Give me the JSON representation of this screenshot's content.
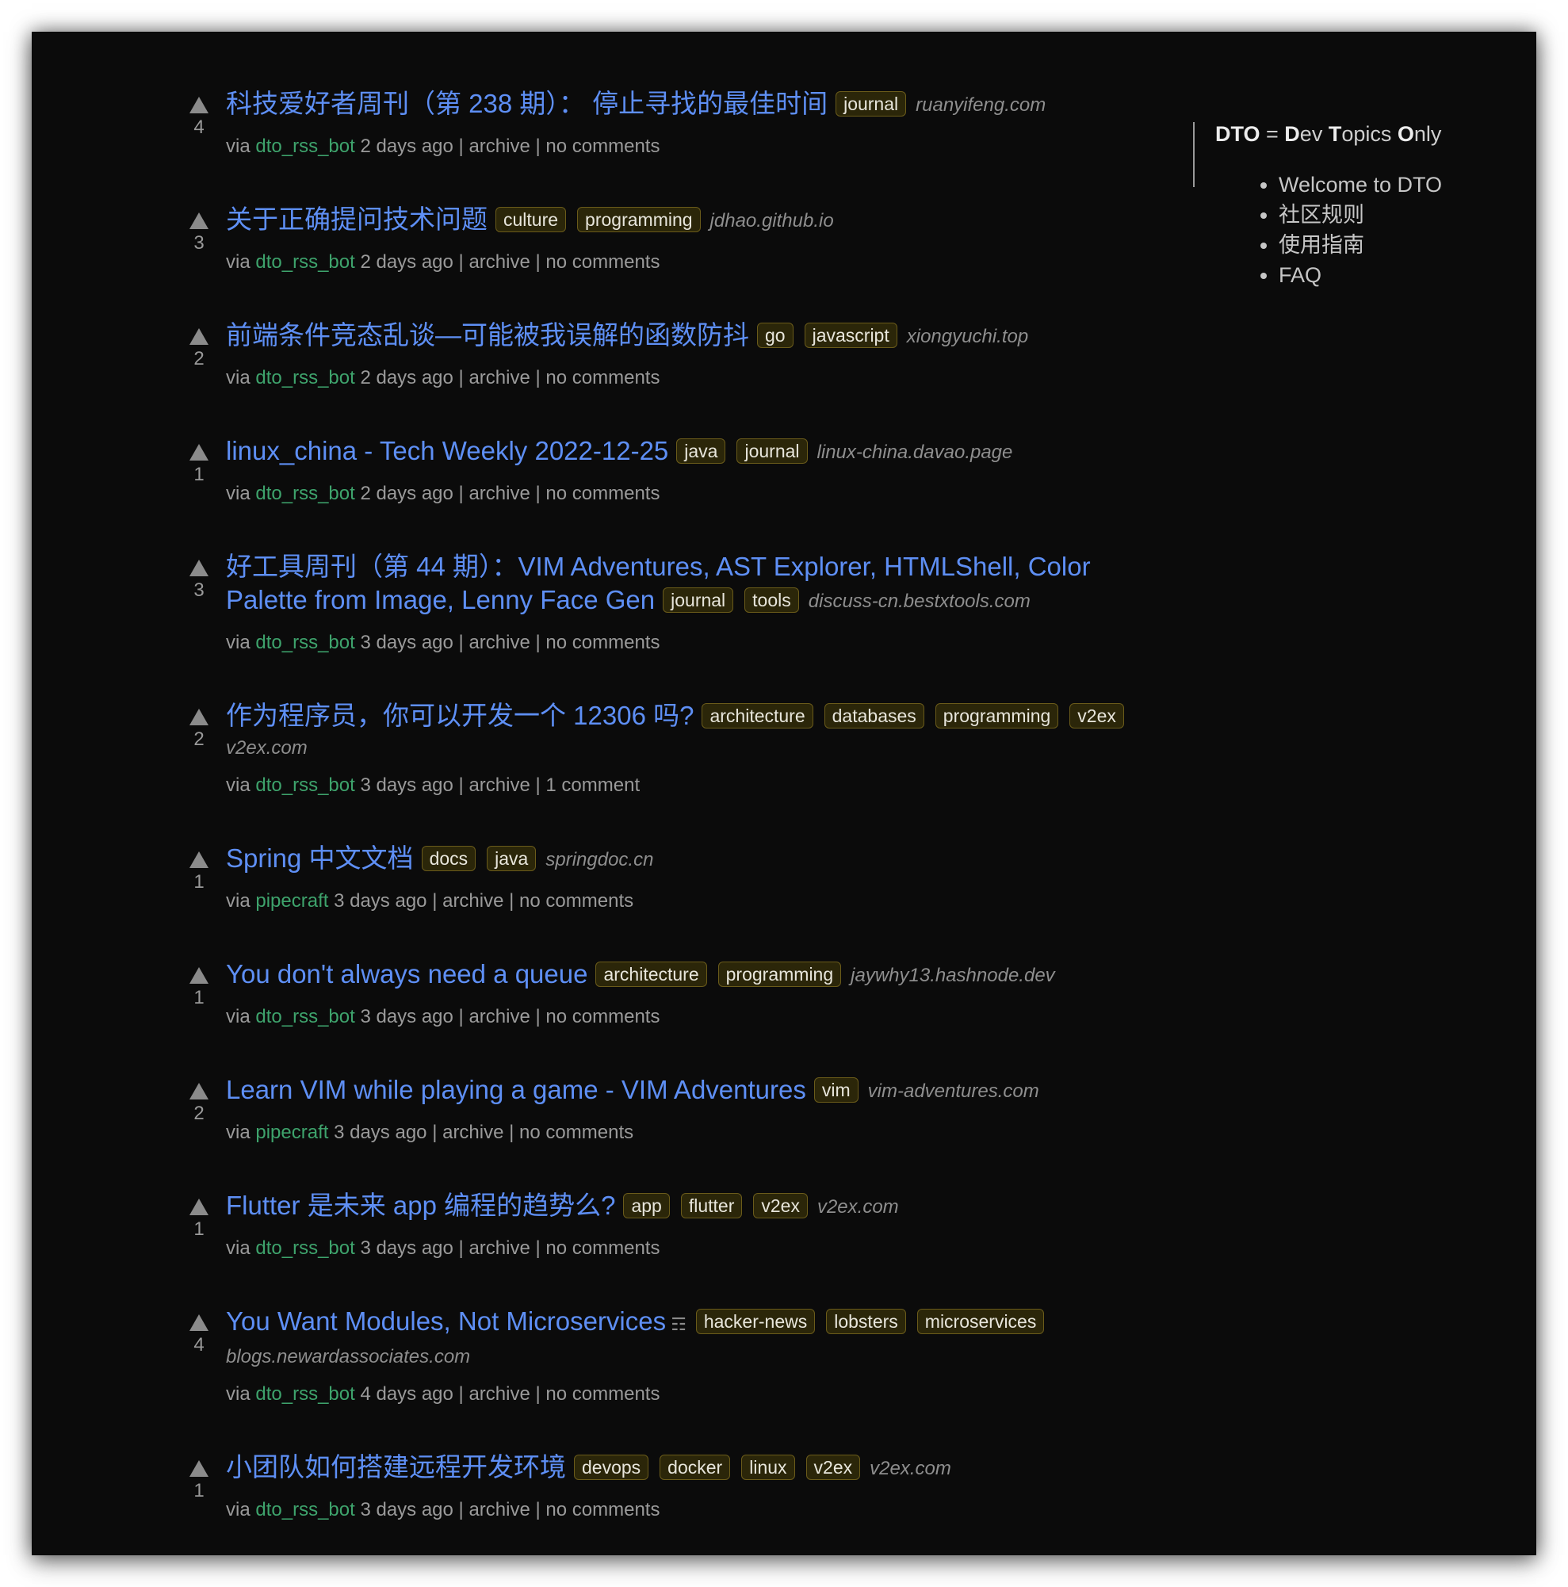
{
  "sidebar": {
    "heading_parts": [
      "DTO",
      " = ",
      "D",
      "ev ",
      "T",
      "opics ",
      "O",
      "nly"
    ],
    "links": [
      "Welcome to DTO",
      "社区规则",
      "使用指南",
      "FAQ"
    ]
  },
  "labels": {
    "via": "via",
    "archive": "archive",
    "separator": "|"
  },
  "colors": {
    "background": "#0b0b0b",
    "title_link": "#5e8ff5",
    "user_link": "#3ea36c",
    "tag_background": "#2b2609",
    "tag_border": "#6a5b1a",
    "muted_text": "#9a9a9a"
  },
  "stories": [
    {
      "score": "4",
      "title": "科技爱好者周刊（第 238 期）： 停止寻找的最佳时间",
      "tags": [
        "journal"
      ],
      "domain": "ruanyifeng.com",
      "user": "dto_rss_bot",
      "time": "2 days ago",
      "comments": "no comments"
    },
    {
      "score": "3",
      "title": "关于正确提问技术问题",
      "tags": [
        "culture",
        "programming"
      ],
      "domain": "jdhao.github.io",
      "user": "dto_rss_bot",
      "time": "2 days ago",
      "comments": "no comments"
    },
    {
      "score": "2",
      "title": "前端条件竞态乱谈—可能被我误解的函数防抖",
      "tags": [
        "go",
        "javascript"
      ],
      "domain": "xiongyuchi.top",
      "user": "dto_rss_bot",
      "time": "2 days ago",
      "comments": "no comments"
    },
    {
      "score": "1",
      "title": "linux_china - Tech Weekly 2022-12-25",
      "tags": [
        "java",
        "journal"
      ],
      "domain": "linux-china.davao.page",
      "user": "dto_rss_bot",
      "time": "2 days ago",
      "comments": "no comments"
    },
    {
      "score": "3",
      "title": "好工具周刊（第 44 期）：VIM Adventures, AST Explorer, HTMLShell, Color Palette from Image, Lenny Face Gen",
      "tags": [
        "journal",
        "tools"
      ],
      "domain": "discuss-cn.bestxtools.com",
      "user": "dto_rss_bot",
      "time": "3 days ago",
      "comments": "no comments"
    },
    {
      "score": "2",
      "title": "作为程序员，你可以开发一个 12306 吗?",
      "tags": [
        "architecture",
        "databases",
        "programming",
        "v2ex"
      ],
      "domain": "v2ex.com",
      "domain_block": true,
      "user": "dto_rss_bot",
      "time": "3 days ago",
      "comments": "1 comment"
    },
    {
      "score": "1",
      "title": "Spring 中文文档",
      "tags": [
        "docs",
        "java"
      ],
      "domain": "springdoc.cn",
      "user": "pipecraft",
      "time": "3 days ago",
      "comments": "no comments"
    },
    {
      "score": "1",
      "title": "You don't always need a queue",
      "tags": [
        "architecture",
        "programming"
      ],
      "domain": "jaywhy13.hashnode.dev",
      "user": "dto_rss_bot",
      "time": "3 days ago",
      "comments": "no comments"
    },
    {
      "score": "2",
      "title": "Learn VIM while playing a game - VIM Adventures",
      "tags": [
        "vim"
      ],
      "domain": "vim-adventures.com",
      "user": "pipecraft",
      "time": "3 days ago",
      "comments": "no comments"
    },
    {
      "score": "1",
      "title": "Flutter 是未来 app 编程的趋势么?",
      "tags": [
        "app",
        "flutter",
        "v2ex"
      ],
      "domain": "v2ex.com",
      "user": "dto_rss_bot",
      "time": "3 days ago",
      "comments": "no comments"
    },
    {
      "score": "4",
      "title": "You Want Modules, Not Microservices",
      "glyph": "☶",
      "tags": [
        "hacker-news",
        "lobsters",
        "microservices"
      ],
      "domain": "blogs.newardassociates.com",
      "domain_block": true,
      "user": "dto_rss_bot",
      "time": "4 days ago",
      "comments": "no comments"
    },
    {
      "score": "1",
      "title": "小团队如何搭建远程开发环境",
      "tags": [
        "devops",
        "docker",
        "linux",
        "v2ex"
      ],
      "domain": "v2ex.com",
      "user": "dto_rss_bot",
      "time": "3 days ago",
      "comments": "no comments"
    }
  ]
}
